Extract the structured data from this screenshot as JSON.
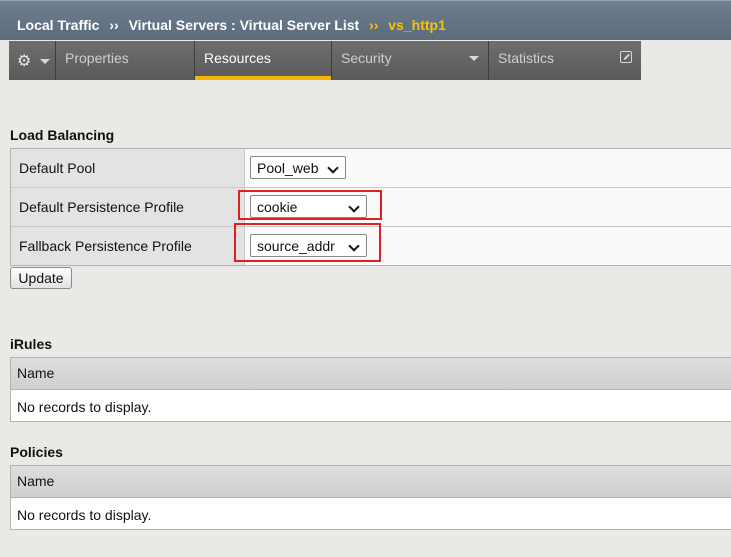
{
  "breadcrumb": {
    "items": [
      "Local Traffic",
      "Virtual Servers : Virtual Server List"
    ],
    "separator": "››",
    "current": "vs_http1"
  },
  "tabs": {
    "gear_icon": "gear-icon",
    "items": [
      {
        "label": "Properties"
      },
      {
        "label": "Resources",
        "active": true
      },
      {
        "label": "Security",
        "has_dropdown": true
      },
      {
        "label": "Statistics",
        "has_external_icon": true
      }
    ]
  },
  "load_balancing": {
    "title": "Load Balancing",
    "rows": [
      {
        "label": "Default Pool",
        "value": "Pool_web"
      },
      {
        "label": "Default Persistence Profile",
        "value": "cookie"
      },
      {
        "label": "Fallback Persistence Profile",
        "value": "source_addr"
      }
    ],
    "update_label": "Update"
  },
  "irules": {
    "title": "iRules",
    "column": "Name",
    "empty": "No records to display."
  },
  "policies": {
    "title": "Policies",
    "column": "Name",
    "empty": "No records to display."
  },
  "colors": {
    "active_tab_accent": "#f2b600",
    "breadcrumb_current": "#f5c400",
    "highlight": "#e21e1e"
  }
}
